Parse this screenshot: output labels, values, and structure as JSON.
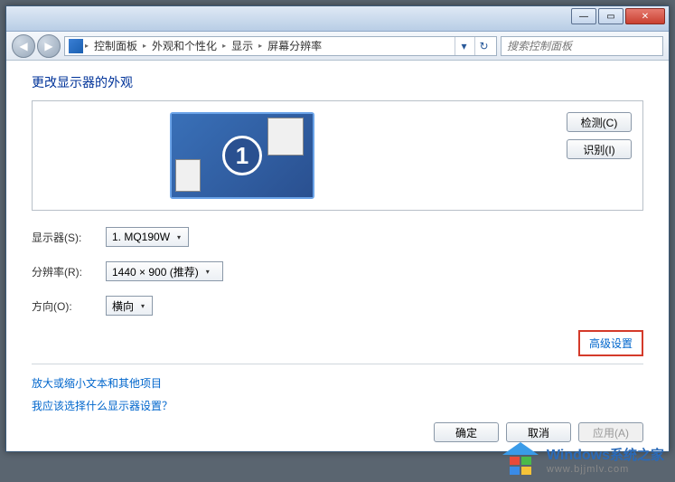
{
  "titlebar": {
    "min_glyph": "—",
    "max_glyph": "▭",
    "close_glyph": "✕"
  },
  "nav": {
    "back_glyph": "◀",
    "forward_glyph": "▶",
    "refresh_glyph": "↻",
    "dropdown_glyph": "▾"
  },
  "breadcrumbs": {
    "items": [
      "控制面板",
      "外观和个性化",
      "显示",
      "屏幕分辨率"
    ],
    "sep": "▸"
  },
  "search": {
    "placeholder": "搜索控制面板"
  },
  "page": {
    "title": "更改显示器的外观",
    "monitor_number": "1",
    "detect_btn": "检测(C)",
    "identify_btn": "识别(I)"
  },
  "form": {
    "display_label": "显示器(S):",
    "display_value": "1. MQ190W",
    "resolution_label": "分辨率(R):",
    "resolution_value": "1440 × 900 (推荐)",
    "orientation_label": "方向(O):",
    "orientation_value": "横向",
    "caret": "▾"
  },
  "links": {
    "advanced": "高级设置",
    "zoom_text": "放大或缩小文本和其他项目",
    "help_choose": "我应该选择什么显示器设置？"
  },
  "buttons": {
    "ok": "确定",
    "cancel": "取消",
    "apply": "应用(A)"
  },
  "watermark": {
    "brand": "Windows",
    "brand_cn": "系统之家",
    "url": "www.bjjmlv.com"
  }
}
